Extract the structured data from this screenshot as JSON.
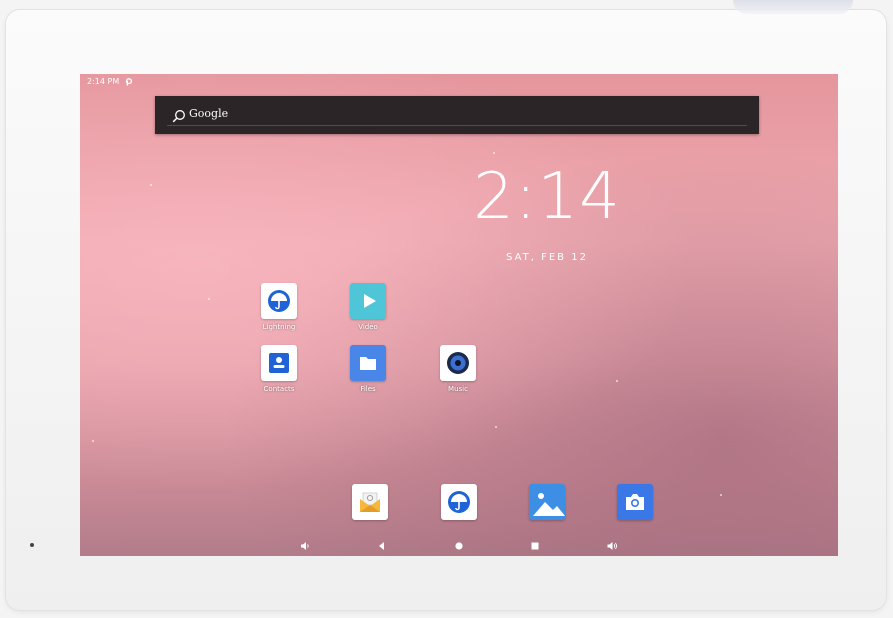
{
  "status_bar": {
    "time": "2:14 PM",
    "notification_icon": "p-icon"
  },
  "search": {
    "label": "Google",
    "icon": "search-icon"
  },
  "clock": {
    "time": "2:14",
    "date": "SAT, FEB 12"
  },
  "apps": [
    {
      "label": "Lightning",
      "icon": "umbrella-icon"
    },
    {
      "label": "Video",
      "icon": "play-icon"
    },
    {
      "label": "Contacts",
      "icon": "contacts-icon"
    },
    {
      "label": "Files",
      "icon": "folder-icon"
    },
    {
      "label": "Music",
      "icon": "music-icon"
    }
  ],
  "dock": [
    {
      "name": "email",
      "icon": "email-icon"
    },
    {
      "name": "browser",
      "icon": "umbrella-icon"
    },
    {
      "name": "gallery",
      "icon": "gallery-icon"
    },
    {
      "name": "camera",
      "icon": "camera-icon"
    }
  ],
  "navbar": [
    {
      "name": "volume-down",
      "icon": "volume-down-icon"
    },
    {
      "name": "back",
      "icon": "back-icon"
    },
    {
      "name": "home",
      "icon": "home-icon"
    },
    {
      "name": "recents",
      "icon": "recents-icon"
    },
    {
      "name": "volume-up",
      "icon": "volume-up-icon"
    }
  ],
  "colors": {
    "searchbar_bg": "#2b2527",
    "video_teal": "#4ec6d8",
    "files_blue": "#4a86e8",
    "lightning_blue": "#1f63d6",
    "gallery_blue": "#3d8fe6",
    "camera_blue": "#3b78e7"
  }
}
